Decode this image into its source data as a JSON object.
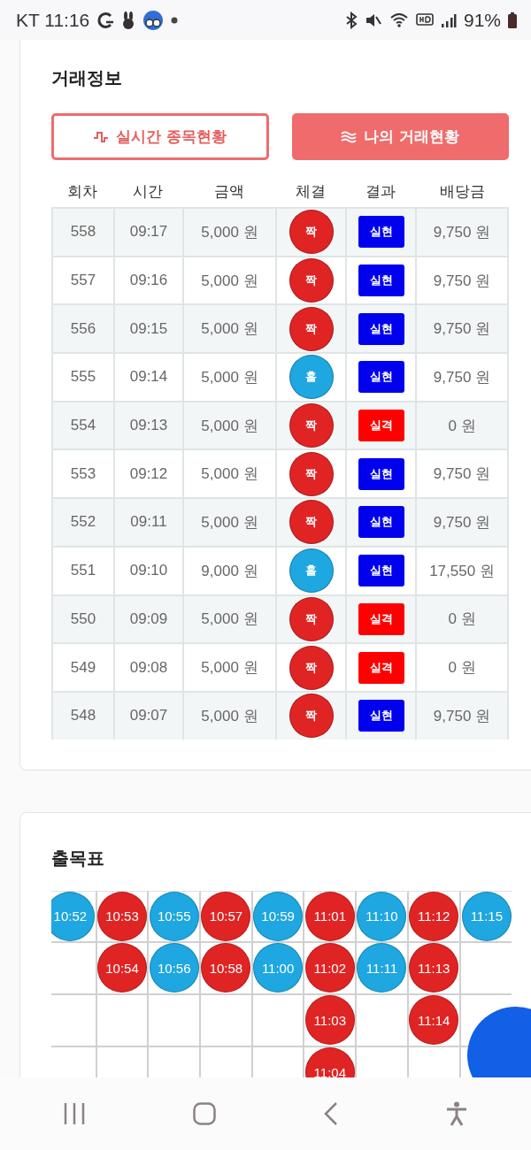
{
  "status_bar": {
    "carrier_time": "KT 11:16",
    "battery": "91%"
  },
  "trade_info": {
    "title": "거래정보",
    "tabs": [
      {
        "label": "실시간 종목현황",
        "selected": false,
        "kind": "pulse"
      },
      {
        "label": "나의 거래현황",
        "selected": true,
        "kind": "waves"
      }
    ],
    "table": {
      "columns": [
        "회차",
        "시간",
        "금액",
        "체결",
        "결과",
        "배당금"
      ],
      "rows": [
        {
          "round": "558",
          "time": "09:17",
          "amount": "5,000 원",
          "outcome": {
            "label": "짝",
            "color": "#e02424"
          },
          "result": {
            "label": "실현",
            "color": "#0000ee"
          },
          "payout": "9,750 원"
        },
        {
          "round": "557",
          "time": "09:16",
          "amount": "5,000 원",
          "outcome": {
            "label": "짝",
            "color": "#e02424"
          },
          "result": {
            "label": "실현",
            "color": "#0000ee"
          },
          "payout": "9,750 원"
        },
        {
          "round": "556",
          "time": "09:15",
          "amount": "5,000 원",
          "outcome": {
            "label": "짝",
            "color": "#e02424"
          },
          "result": {
            "label": "실현",
            "color": "#0000ee"
          },
          "payout": "9,750 원"
        },
        {
          "round": "555",
          "time": "09:14",
          "amount": "5,000 원",
          "outcome": {
            "label": "홀",
            "color": "#1ea7e0"
          },
          "result": {
            "label": "실현",
            "color": "#0000ee"
          },
          "payout": "9,750 원"
        },
        {
          "round": "554",
          "time": "09:13",
          "amount": "5,000 원",
          "outcome": {
            "label": "짝",
            "color": "#e02424"
          },
          "result": {
            "label": "실격",
            "color": "#ff0000"
          },
          "payout": "0 원"
        },
        {
          "round": "553",
          "time": "09:12",
          "amount": "5,000 원",
          "outcome": {
            "label": "짝",
            "color": "#e02424"
          },
          "result": {
            "label": "실현",
            "color": "#0000ee"
          },
          "payout": "9,750 원"
        },
        {
          "round": "552",
          "time": "09:11",
          "amount": "5,000 원",
          "outcome": {
            "label": "짝",
            "color": "#e02424"
          },
          "result": {
            "label": "실현",
            "color": "#0000ee"
          },
          "payout": "9,750 원"
        },
        {
          "round": "551",
          "time": "09:10",
          "amount": "9,000 원",
          "outcome": {
            "label": "홀",
            "color": "#1ea7e0"
          },
          "result": {
            "label": "실현",
            "color": "#0000ee"
          },
          "payout": "17,550 원"
        },
        {
          "round": "550",
          "time": "09:09",
          "amount": "5,000 원",
          "outcome": {
            "label": "짝",
            "color": "#e02424"
          },
          "result": {
            "label": "실격",
            "color": "#ff0000"
          },
          "payout": "0 원"
        },
        {
          "round": "549",
          "time": "09:08",
          "amount": "5,000 원",
          "outcome": {
            "label": "짝",
            "color": "#e02424"
          },
          "result": {
            "label": "실격",
            "color": "#ff0000"
          },
          "payout": "0 원"
        },
        {
          "round": "548",
          "time": "09:07",
          "amount": "5,000 원",
          "outcome": {
            "label": "짝",
            "color": "#e02424"
          },
          "result": {
            "label": "실현",
            "color": "#0000ee"
          },
          "payout": "9,750 원"
        }
      ]
    }
  },
  "result_board": {
    "title": "출목표",
    "columns": [
      [
        {
          "time": "10:52",
          "color": "#1ea7e0"
        }
      ],
      [
        {
          "time": "10:53",
          "color": "#e02424"
        },
        {
          "time": "10:54",
          "color": "#e02424"
        }
      ],
      [
        {
          "time": "10:55",
          "color": "#1ea7e0"
        },
        {
          "time": "10:56",
          "color": "#1ea7e0"
        }
      ],
      [
        {
          "time": "10:57",
          "color": "#e02424"
        },
        {
          "time": "10:58",
          "color": "#e02424"
        }
      ],
      [
        {
          "time": "10:59",
          "color": "#1ea7e0"
        },
        {
          "time": "11:00",
          "color": "#1ea7e0"
        }
      ],
      [
        {
          "time": "11:01",
          "color": "#e02424"
        },
        {
          "time": "11:02",
          "color": "#e02424"
        },
        {
          "time": "11:03",
          "color": "#e02424"
        },
        {
          "time": "11:04",
          "color": "#e02424"
        }
      ],
      [
        {
          "time": "11:10",
          "color": "#1ea7e0"
        },
        {
          "time": "11:11",
          "color": "#1ea7e0"
        }
      ],
      [
        {
          "time": "11:12",
          "color": "#e02424"
        },
        {
          "time": "11:13",
          "color": "#e02424"
        },
        {
          "time": "11:14",
          "color": "#e02424"
        }
      ],
      [
        {
          "time": "11:15",
          "color": "#1ea7e0"
        }
      ]
    ]
  }
}
